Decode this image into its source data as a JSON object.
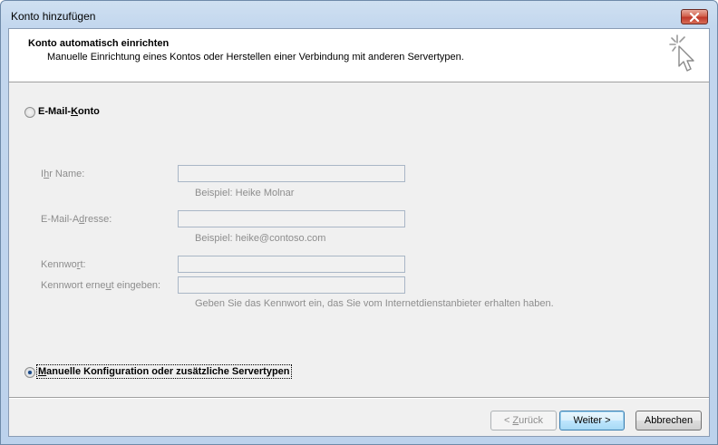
{
  "window": {
    "title": "Konto hinzufügen",
    "close_icon": "close-icon"
  },
  "header": {
    "title": "Konto automatisch einrichten",
    "subtitle": "Manuelle Einrichtung eines Kontos oder Herstellen einer Verbindung mit anderen Servertypen.",
    "icon": "wizard-sparkle-cursor-icon"
  },
  "email_option": {
    "label_before": "E-Mail-",
    "label_accel": "K",
    "label_after": "onto",
    "selected": false
  },
  "form": {
    "name": {
      "label_before": "I",
      "label_accel": "h",
      "label_after": "r Name:",
      "value": "",
      "hint": "Beispiel: Heike Molnar"
    },
    "email": {
      "label_before": "E-Mail-A",
      "label_accel": "d",
      "label_after": "resse:",
      "value": "",
      "hint": "Beispiel: heike@contoso.com"
    },
    "password": {
      "label_before": "Kennwo",
      "label_accel": "r",
      "label_after": "t:",
      "value": ""
    },
    "password_repeat": {
      "label_before": "Kennwort erne",
      "label_accel": "u",
      "label_after": "t eingeben:",
      "value": ""
    },
    "password_hint": "Geben Sie das Kennwort ein, das Sie vom Internetdienstanbieter erhalten haben."
  },
  "manual_option": {
    "label_before": "",
    "label_accel": "M",
    "label_after": "anuelle Konfiguration oder zusätzliche Servertypen",
    "selected": true
  },
  "buttons": {
    "back": {
      "prefix": "< ",
      "accel": "Z",
      "rest": "urück",
      "enabled": false
    },
    "next": {
      "label": "Weiter >",
      "default": true
    },
    "cancel": {
      "label": "Abbrechen"
    }
  }
}
